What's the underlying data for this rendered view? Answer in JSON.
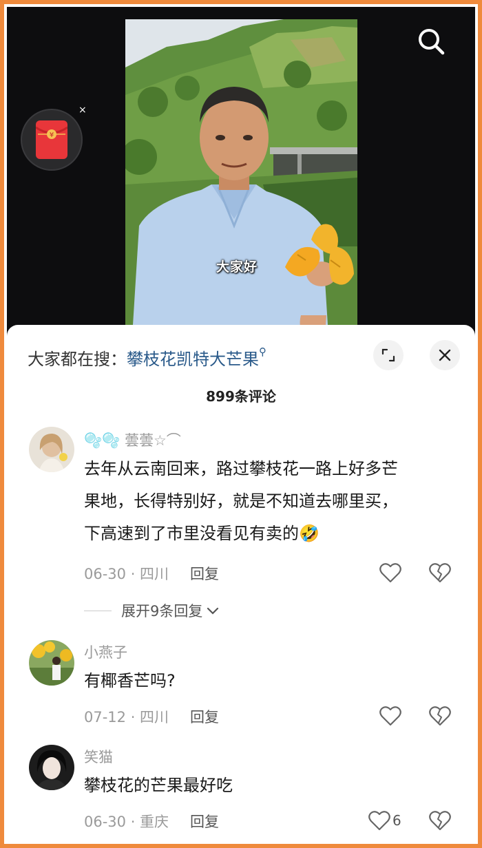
{
  "video": {
    "subtitle": "大家好"
  },
  "icons": {
    "search": "search-icon",
    "red_packet": "red-packet-icon",
    "close_small": "×"
  },
  "sheet": {
    "search_prefix": "大家都在搜：",
    "search_term": "攀枝花凯特大芒果",
    "comment_count": "899条评论"
  },
  "comments": [
    {
      "username": "🫧🫧 蕓蕓☆⌒",
      "text_lines": [
        "去年从云南回来，路过攀枝花一路上好多芒",
        "果地，长得特别好，就是不知道去哪里买，",
        "下高速到了市里没看见有卖的🤣"
      ],
      "meta": "06-30 · 四川",
      "reply_label": "回复",
      "expand_label": "展开9条回复",
      "likes": ""
    },
    {
      "username": "小燕子",
      "text_lines": [
        "有椰香芒吗?"
      ],
      "meta": "07-12 · 四川",
      "reply_label": "回复",
      "likes": ""
    },
    {
      "username": "笑猫",
      "text_lines": [
        "攀枝花的芒果最好吃"
      ],
      "meta": "06-30 · 重庆",
      "reply_label": "回复",
      "likes": "6"
    }
  ],
  "colors": {
    "frame": "#ef8a3c",
    "link": "#2a5a8a",
    "red_packet": "#e8363a"
  }
}
